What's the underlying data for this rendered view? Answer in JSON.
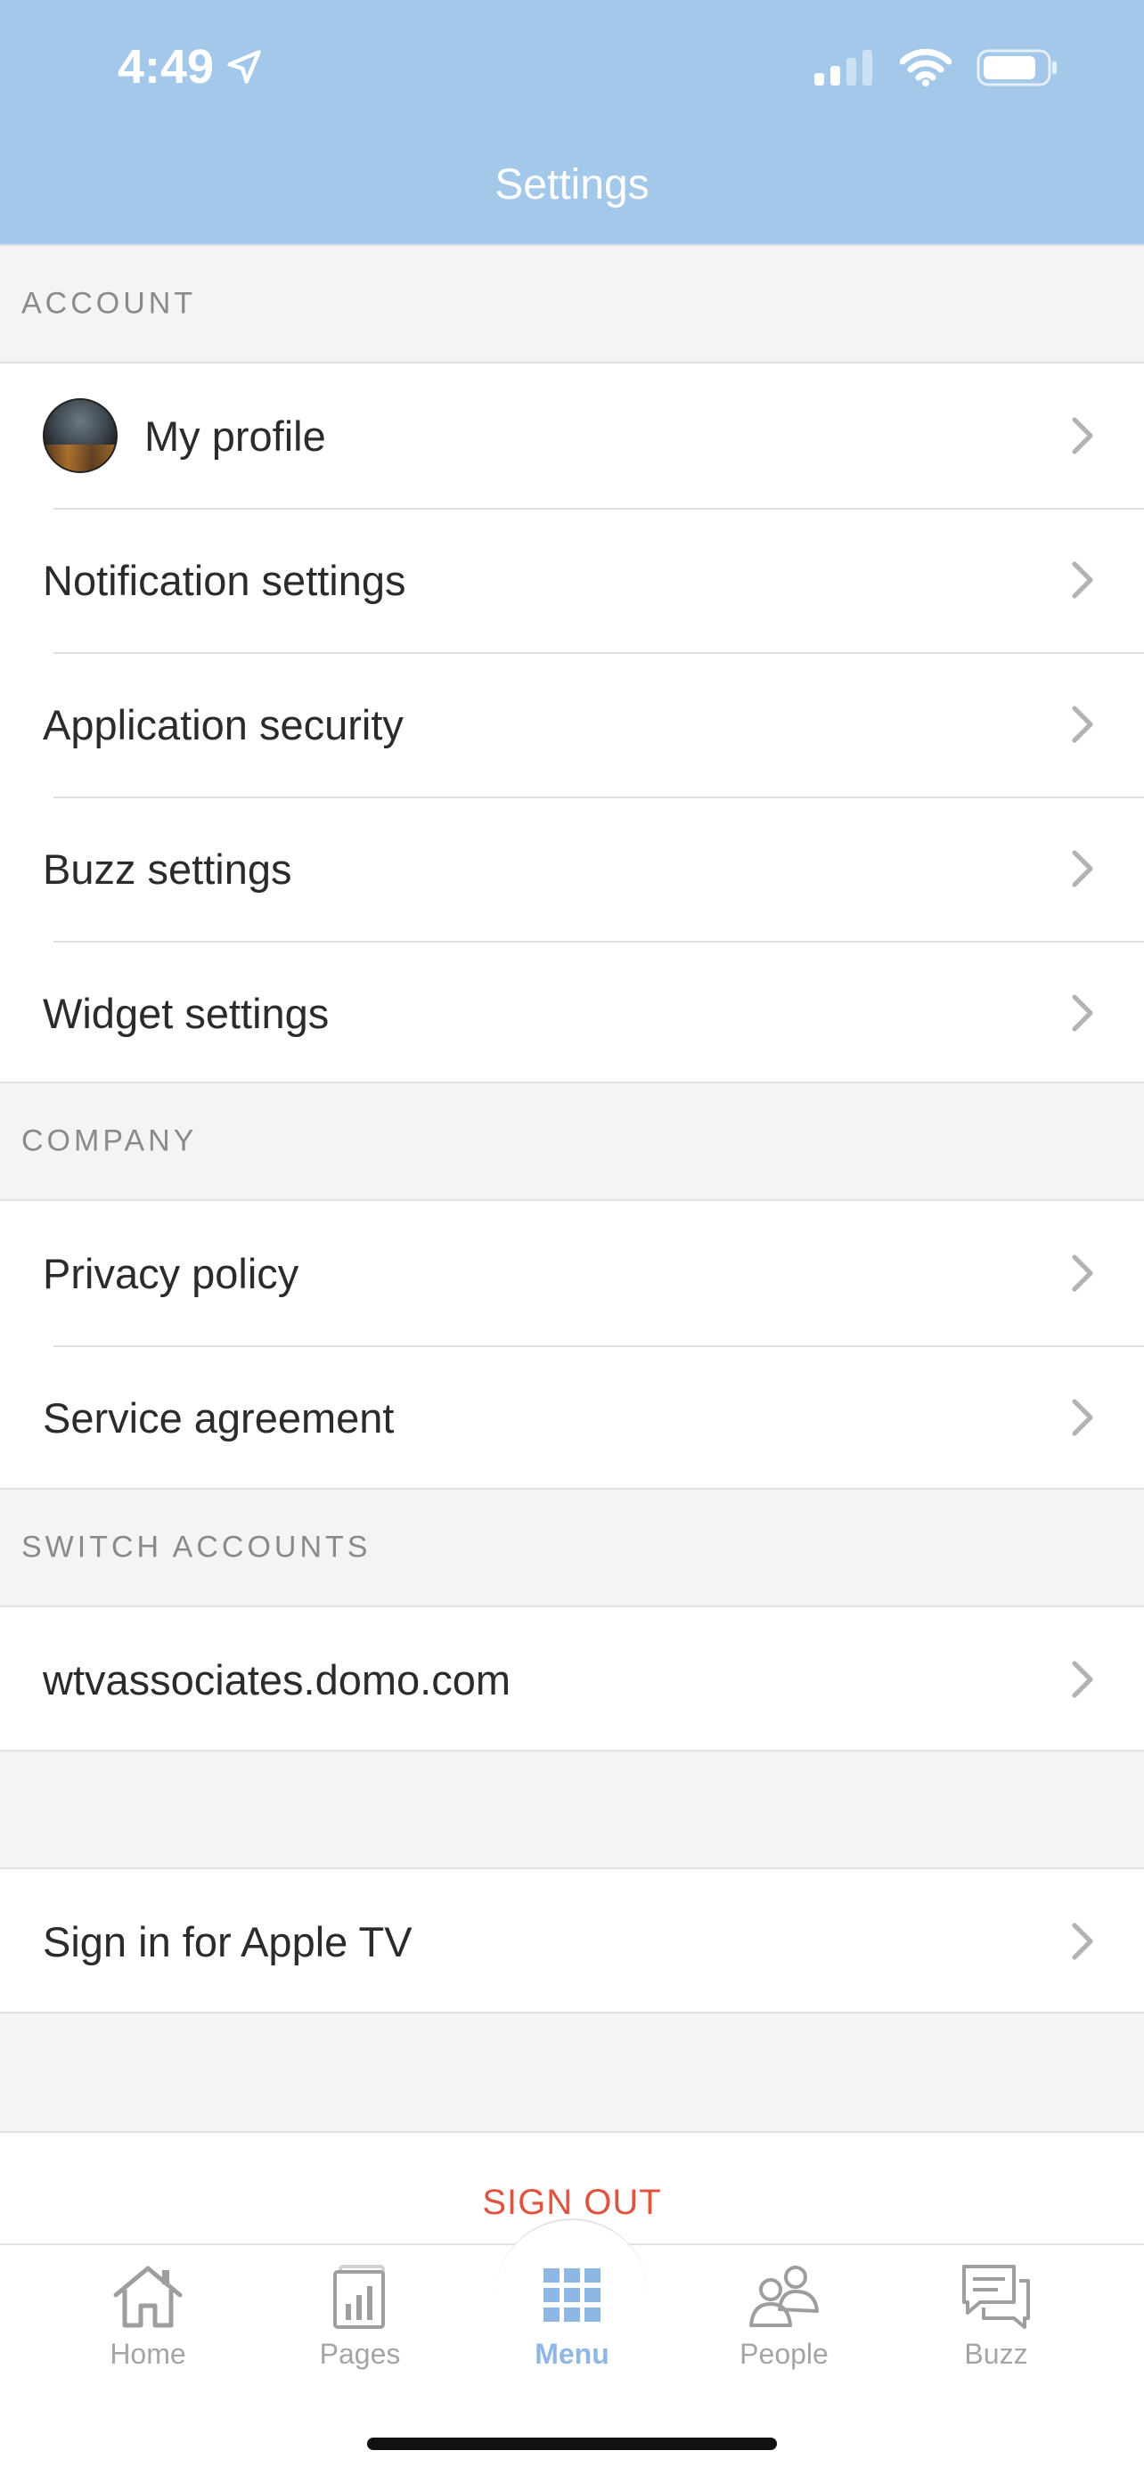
{
  "status_bar": {
    "time": "4:49"
  },
  "header": {
    "title": "Settings"
  },
  "sections": {
    "account": {
      "title": "ACCOUNT",
      "items": [
        {
          "label": "My profile"
        },
        {
          "label": "Notification settings"
        },
        {
          "label": "Application security"
        },
        {
          "label": "Buzz settings"
        },
        {
          "label": "Widget settings"
        }
      ]
    },
    "company": {
      "title": "COMPANY",
      "items": [
        {
          "label": "Privacy policy"
        },
        {
          "label": "Service agreement"
        }
      ]
    },
    "switch_accounts": {
      "title": "SWITCH ACCOUNTS",
      "items": [
        {
          "label": "wtvassociates.domo.com"
        }
      ]
    },
    "apple_tv": {
      "items": [
        {
          "label": "Sign in for Apple TV"
        }
      ]
    }
  },
  "sign_out": {
    "label": "SIGN OUT",
    "color": "#e0533f"
  },
  "tab_bar": {
    "tabs": [
      {
        "label": "Home",
        "icon": "home-icon"
      },
      {
        "label": "Pages",
        "icon": "pages-icon"
      },
      {
        "label": "Menu",
        "icon": "grid-icon",
        "active": true
      },
      {
        "label": "People",
        "icon": "people-icon"
      },
      {
        "label": "Buzz",
        "icon": "chat-icon"
      }
    ],
    "active_color": "#8fb7e3"
  },
  "theme": {
    "header_color": "#a3c8ea"
  }
}
